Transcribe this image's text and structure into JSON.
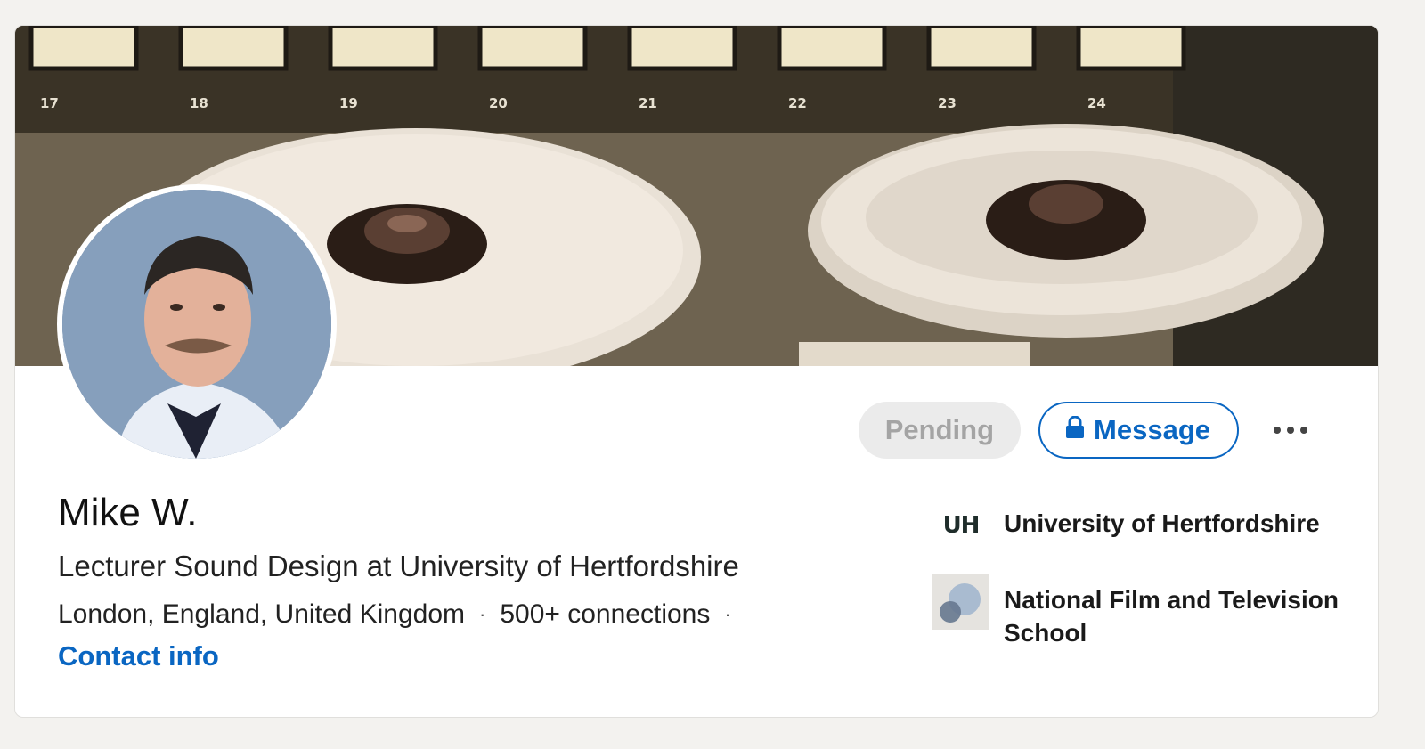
{
  "profile": {
    "name": "Mike W.",
    "headline": "Lecturer Sound Design at University of Hertfordshire",
    "location": "London, England, United Kingdom",
    "connections": "500+ connections",
    "separator": "·",
    "contact_label": "Contact info"
  },
  "actions": {
    "pending_label": "Pending",
    "message_label": "Message",
    "message_icon": "lock-icon",
    "more_icon": "more-horizontal-icon"
  },
  "organizations": [
    {
      "name": "University of Hertfordshire",
      "logo": "UH"
    },
    {
      "name": "National Film and Television School",
      "logo_icon": "nfts-logo-icon"
    }
  ],
  "banner": {
    "meter_numbers": [
      "17",
      "18",
      "19",
      "20",
      "21",
      "22",
      "23",
      "24"
    ]
  },
  "colors": {
    "accent": "#0a66c2",
    "pending_bg": "#ebebeb",
    "pending_text": "#a4a4a4",
    "page_bg": "#f3f2ef"
  }
}
